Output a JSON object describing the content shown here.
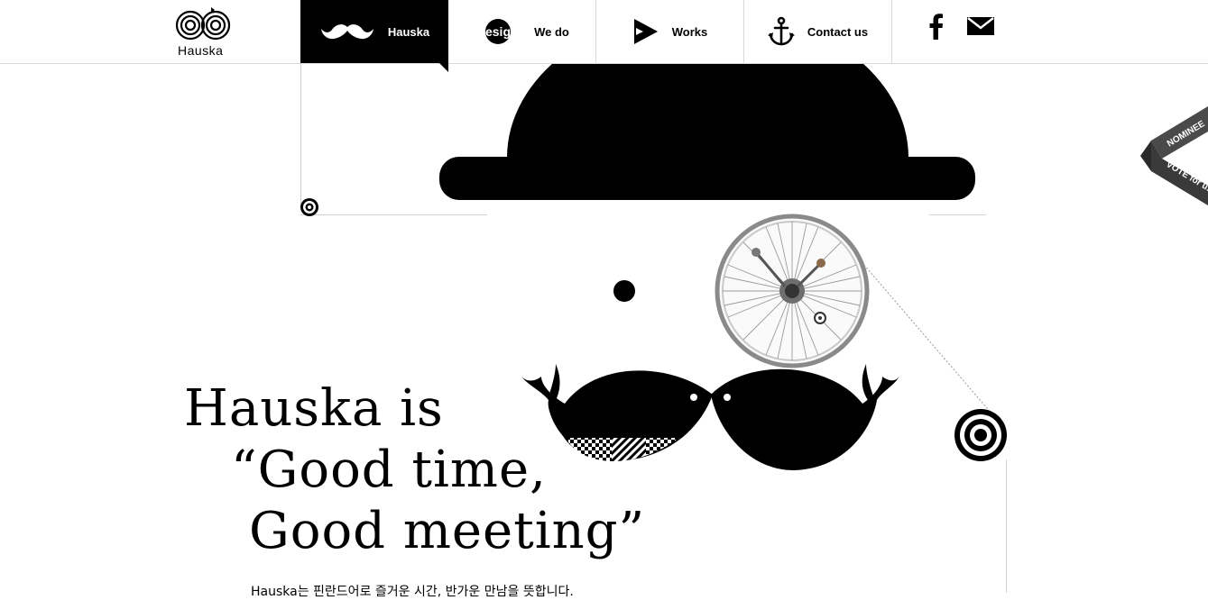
{
  "brand": {
    "logo_text": "Hauska"
  },
  "nav": {
    "items": [
      {
        "label": "Hauska",
        "icon": "mustache-icon",
        "active": true
      },
      {
        "label": "We do",
        "icon": "design-badge-icon",
        "badge_text": "design"
      },
      {
        "label": "Works",
        "icon": "play-icon"
      },
      {
        "label": "Contact us",
        "icon": "anchor-icon"
      }
    ]
  },
  "social": {
    "facebook_icon": "facebook-icon",
    "mail_icon": "mail-icon"
  },
  "headline": {
    "line1": "Hauska is",
    "line2": "“Good time,",
    "line3": "Good meeting”"
  },
  "subtext": "Hauska는 핀란드어로 즐거운 시간, 반가운 만남을 뜻합니다.",
  "ribbon": {
    "top_text": "NOMINEE",
    "bottom_text": "VOTE for us"
  },
  "colors": {
    "primary": "#000000",
    "background": "#ffffff",
    "divider": "#d8d8d8"
  }
}
